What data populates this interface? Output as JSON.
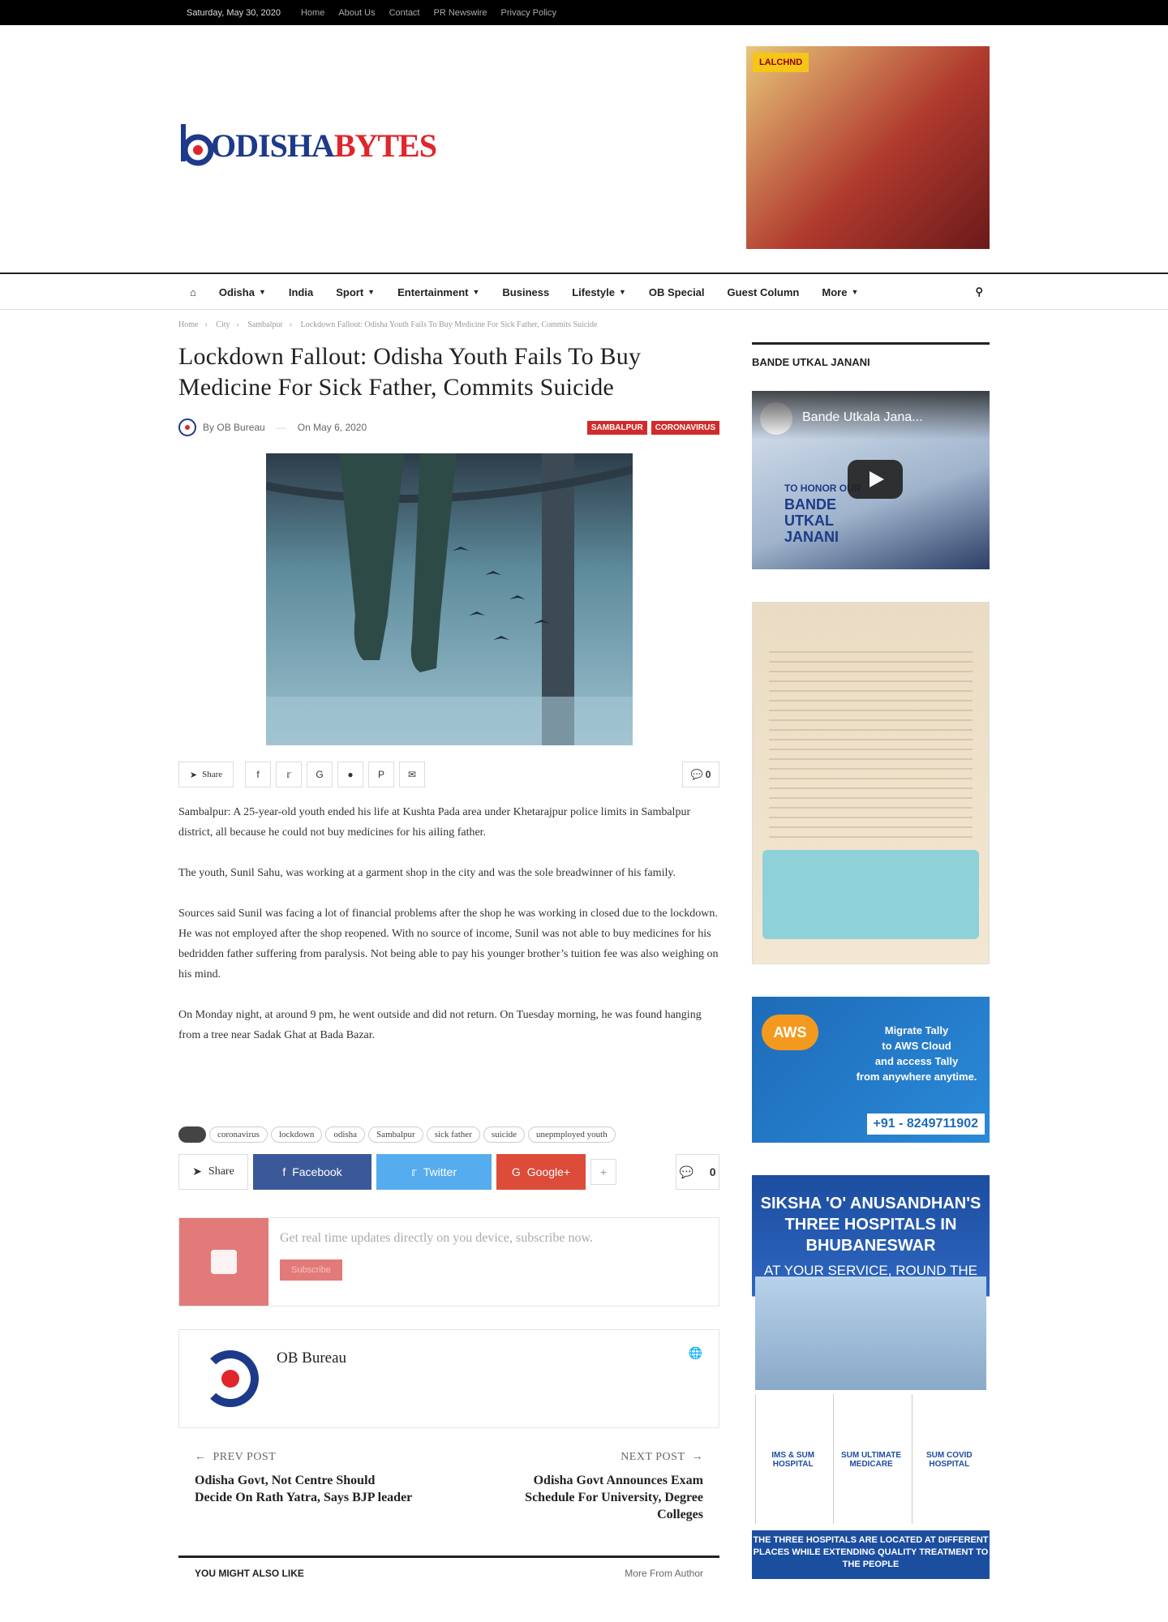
{
  "topbar": {
    "date": "Saturday, May 30, 2020",
    "links": [
      "Home",
      "About Us",
      "Contact",
      "PR Newswire",
      "Privacy Policy"
    ]
  },
  "brand": {
    "part1": "ODISHA",
    "part2": "BYTES",
    "colors": {
      "blue": "#1d3a8a",
      "red": "#e0262b"
    }
  },
  "ad_top": {
    "label": "LALCHND"
  },
  "nav": {
    "items": [
      "Odisha",
      "India",
      "Sport",
      "Entertainment",
      "Business",
      "Lifestyle",
      "OB Special",
      "Guest Column",
      "More"
    ],
    "dropdown": [
      true,
      false,
      true,
      true,
      false,
      true,
      false,
      false,
      true
    ]
  },
  "breadcrumb": [
    "Home",
    "City",
    "Sambalpur",
    "Lockdown Fallout: Odisha Youth Fails To Buy Medicine For Sick Father, Commits Suicide"
  ],
  "article": {
    "title": "Lockdown Fallout: Odisha Youth Fails To Buy Medicine For Sick Father, Commits Suicide",
    "by": "By",
    "author": "OB Bureau",
    "on": "On",
    "date": "May 6, 2020",
    "categories": [
      "SAMBALPUR",
      "CORONAVIRUS"
    ],
    "share_label": "Share",
    "comment_count": "0",
    "paragraphs": [
      "Sambalpur: A 25-year-old youth ended his life at Kushta Pada area under Khetarajpur police limits in Sambalpur district, all because he could not buy medicines for his ailing father.",
      "The youth, Sunil Sahu, was working at a garment shop in the city and was the sole breadwinner of his family.",
      "Sources said Sunil was facing a lot of financial problems after the shop he was working in closed due to the lockdown. He was not employed after the shop reopened. With no source of income, Sunil was not able to  buy medicines for his bedridden father suffering from paralysis. Not being able to pay his younger brother’s tuition fee was also weighing on his mind.",
      "On Monday night, at around 9 pm, he went outside and did not return. On Tuesday morning, he was found hanging from a tree near Sadak Ghat at Bada Bazar."
    ],
    "tags": [
      "coronavirus",
      "lockdown",
      "odisha",
      "Sambalpur",
      "sick father",
      "suicide",
      "unepmployed youth"
    ]
  },
  "share": {
    "label": "Share",
    "facebook": "Facebook",
    "twitter": "Twitter",
    "google": "Google+",
    "count": "0"
  },
  "subscribe": {
    "text": "Get real time updates directly on you device, subscribe now.",
    "button": "Subscribe"
  },
  "author_box": {
    "name": "OB Bureau"
  },
  "post_nav": {
    "prev_label": "PREV POST",
    "prev_title": "Odisha Govt, Not Centre Should Decide On Rath Yatra, Says BJP leader",
    "next_label": "NEXT POST",
    "next_title": "Odisha Govt Announces Exam Schedule For University, Degree Colleges"
  },
  "related": {
    "title": "YOU MIGHT ALSO LIKE",
    "more": "More From Author"
  },
  "sidebar": {
    "widget_title": "BANDE UTKAL JANANI",
    "video": {
      "title": "Bande Utkala Jana...",
      "caption_l1": "TO HONOR OUR",
      "caption_l2": "BANDE",
      "caption_l3": "UTKAL",
      "caption_l4": "JANANI"
    },
    "ad_aws": {
      "badge": "AWS",
      "line1": "Migrate Tally",
      "line2": "to AWS Cloud",
      "line3": "and access Tally",
      "line4": "from anywhere anytime.",
      "phone": "+91 - 8249711902"
    },
    "ad_soa": {
      "title1": "SIKSHA 'O' ANUSANDHAN'S",
      "title2": "THREE HOSPITALS IN BHUBANESWAR",
      "subtitle": "AT YOUR SERVICE, ROUND THE CLOCK",
      "col1": "IMS & SUM HOSPITAL",
      "col2": "SUM ULTIMATE MEDICARE",
      "col3": "SUM COVID HOSPITAL",
      "footer": "THE THREE HOSPITALS ARE LOCATED AT DIFFERENT PLACES WHILE EXTENDING QUALITY TREATMENT TO THE PEOPLE"
    }
  }
}
